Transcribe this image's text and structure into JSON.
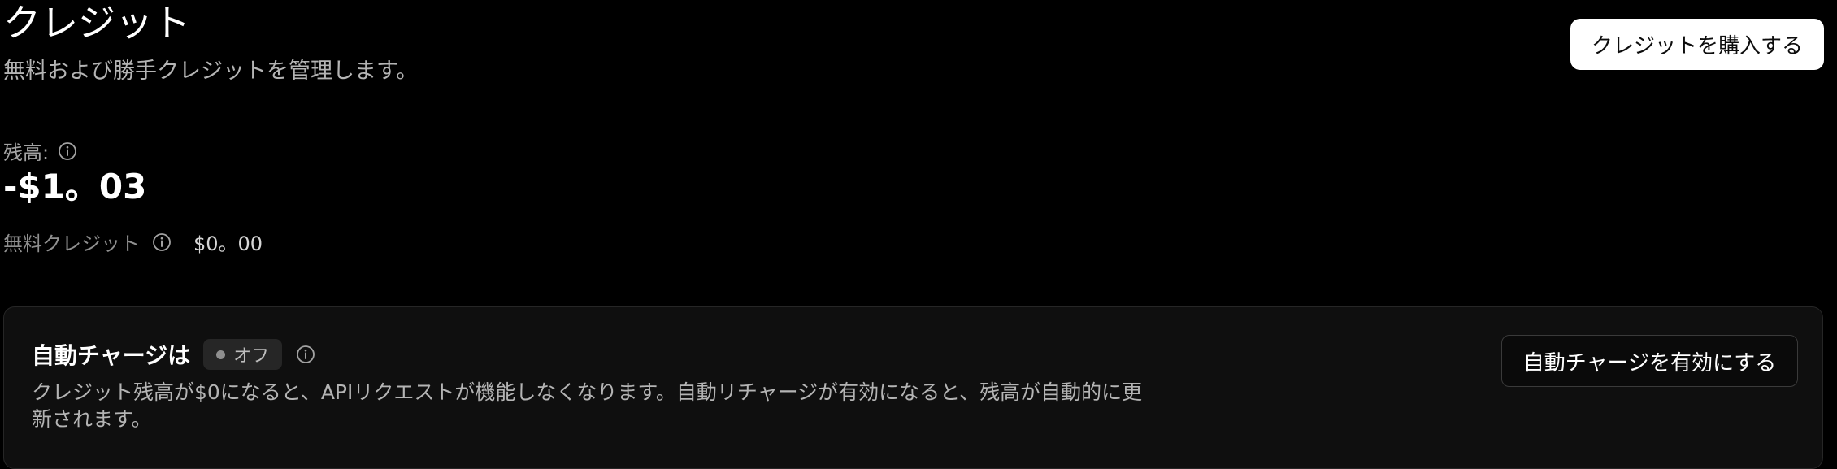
{
  "header": {
    "title": "クレジット",
    "subtitle": "無料および勝手クレジットを管理します。",
    "buy_button_label": "クレジットを購入する"
  },
  "balance": {
    "label": "残高:",
    "value": "-$1。03",
    "info_icon": "info-icon"
  },
  "free_credit": {
    "label": "無料クレジット",
    "value": "$0。00",
    "info_icon": "info-icon"
  },
  "auto_recharge": {
    "title": "自動チャージは",
    "status": "オフ",
    "description": "クレジット残高が$0になると、APIリクエストが機能しなくなります。自動リチャージが有効になると、残高が自動的に更新されます。",
    "enable_button_label": "自動チャージを有効にする",
    "info_icon": "info-icon"
  },
  "colors": {
    "background": "#000000",
    "card_background": "#0f0f0f",
    "primary_button": "#ffffff",
    "muted_text": "#a3a3a3"
  }
}
